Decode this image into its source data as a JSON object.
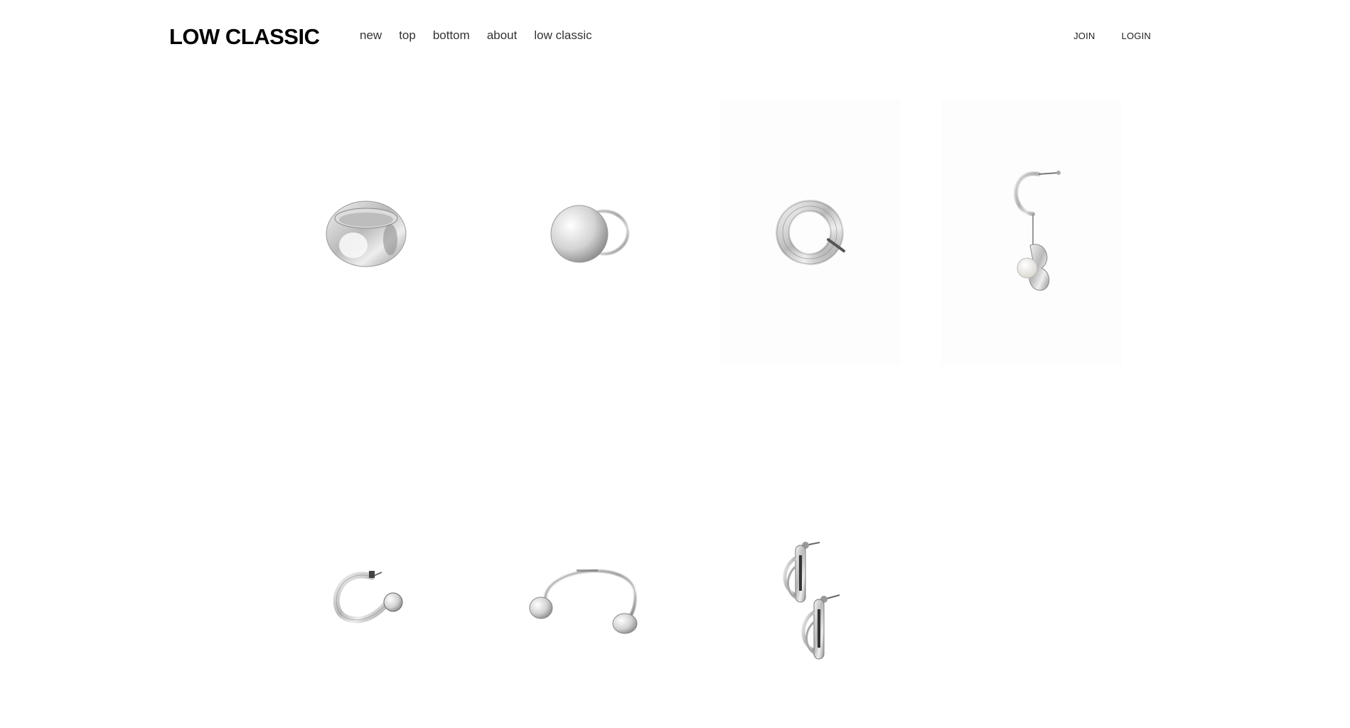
{
  "header": {
    "logo": "LOW CLASSIC",
    "nav": [
      "new",
      "top",
      "bottom",
      "about",
      "low classic"
    ],
    "auth": {
      "join": "JOIN",
      "login": "LOGIN"
    }
  },
  "products": [
    {
      "name": "dome-ring"
    },
    {
      "name": "ball-ring"
    },
    {
      "name": "wrap-ring"
    },
    {
      "name": "pearl-hoop-earring"
    },
    {
      "name": "ball-hoop-earring"
    },
    {
      "name": "open-cuff-bracelet"
    },
    {
      "name": "bar-drop-earrings"
    }
  ],
  "colors": {
    "background": "#ffffff",
    "logo": "#000000",
    "nav_text": "#333333",
    "silver": "#c8c8c8"
  }
}
